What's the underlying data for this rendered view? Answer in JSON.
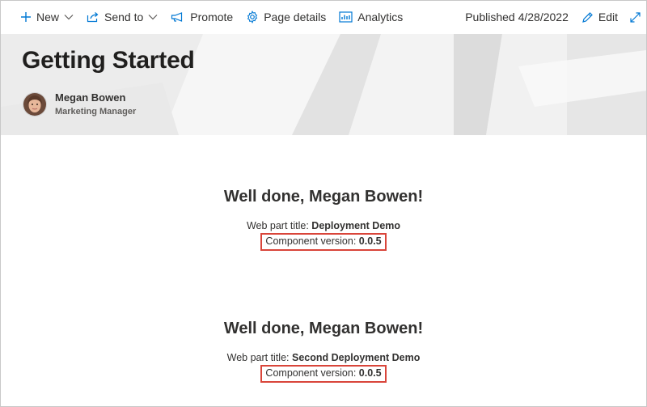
{
  "commandbar": {
    "new_label": "New",
    "send_to_label": "Send to",
    "promote_label": "Promote",
    "page_details_label": "Page details",
    "analytics_label": "Analytics",
    "published_text": "Published 4/28/2022",
    "edit_label": "Edit"
  },
  "header": {
    "title": "Getting Started",
    "author_name": "Megan Bowen",
    "author_role": "Marketing Manager"
  },
  "webparts": [
    {
      "greeting": "Well done, Megan Bowen!",
      "title_label": "Web part title: ",
      "title_value": "Deployment Demo",
      "version_label": "Component version: ",
      "version_value": "0.0.5"
    },
    {
      "greeting": "Well done, Megan Bowen!",
      "title_label": "Web part title: ",
      "title_value": "Second Deployment Demo",
      "version_label": "Component version: ",
      "version_value": "0.0.5"
    }
  ],
  "colors": {
    "accent": "#0078d4",
    "highlight_border": "#d9453a"
  },
  "icons": {
    "new": "plus-icon",
    "send_to": "share-icon",
    "promote": "megaphone-icon",
    "page_details": "gear-icon",
    "analytics": "analytics-icon",
    "edit": "pencil-icon",
    "expand": "expand-icon"
  }
}
